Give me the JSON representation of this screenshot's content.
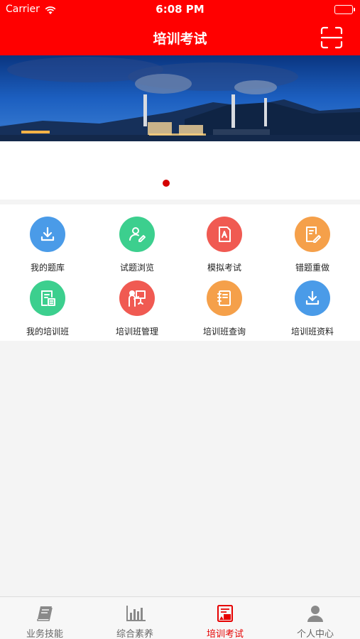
{
  "status_bar": {
    "carrier": "Carrier",
    "time": "6:08 PM"
  },
  "header": {
    "title": "培训考试",
    "scan_icon": "scan-icon"
  },
  "banner": {
    "page_count": 1,
    "current_page": 1
  },
  "grid": {
    "items": [
      {
        "label": "我的题库",
        "icon": "download-icon",
        "color": "#4a9be8"
      },
      {
        "label": "试题浏览",
        "icon": "user-edit-icon",
        "color": "#3ccf8e"
      },
      {
        "label": "模拟考试",
        "icon": "exam-paper-icon",
        "color": "#f05a52"
      },
      {
        "label": "错题重做",
        "icon": "document-edit-icon",
        "color": "#f5a04a"
      },
      {
        "label": "我的培训班",
        "icon": "document-list-icon",
        "color": "#3ccf8e"
      },
      {
        "label": "培训班管理",
        "icon": "presenter-icon",
        "color": "#f05a52"
      },
      {
        "label": "培训班查询",
        "icon": "notebook-icon",
        "color": "#f5a04a"
      },
      {
        "label": "培训班资料",
        "icon": "download-icon",
        "color": "#4a9be8"
      }
    ]
  },
  "tab_bar": {
    "tabs": [
      {
        "label": "业务技能",
        "icon": "book-icon",
        "active": false
      },
      {
        "label": "综合素养",
        "icon": "bar-chart-icon",
        "active": false
      },
      {
        "label": "培训考试",
        "icon": "exam-icon",
        "active": true
      },
      {
        "label": "个人中心",
        "icon": "person-icon",
        "active": false
      }
    ]
  },
  "colors": {
    "brand": "#ff0000",
    "active_tab": "#e60000",
    "inactive_tab": "#666666"
  }
}
